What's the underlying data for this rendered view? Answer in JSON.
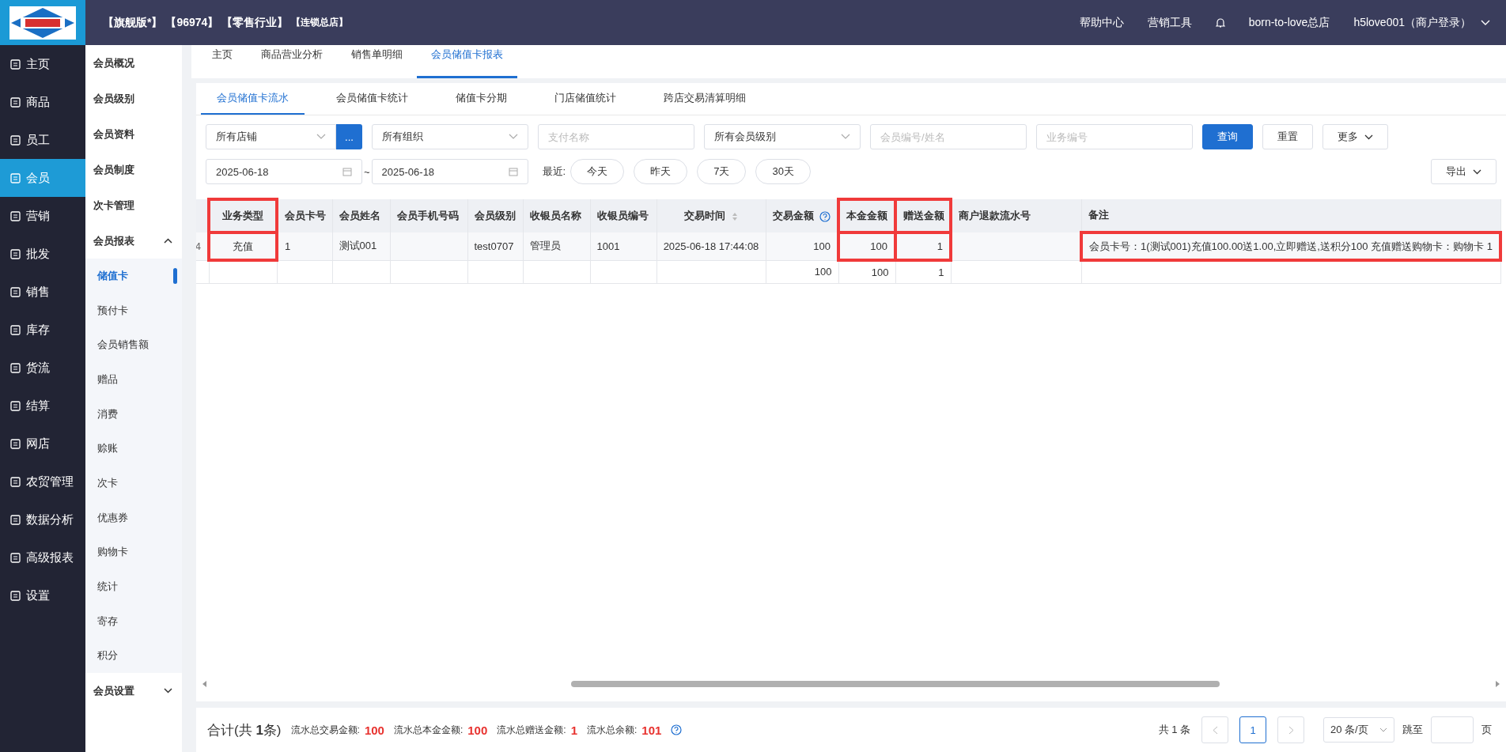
{
  "topbar": {
    "info": [
      "【旗舰版*】",
      "【96974】",
      "【零售行业】",
      "【连锁总店】"
    ],
    "links": [
      "帮助中心",
      "营销工具"
    ],
    "store": "born-to-love总店",
    "user": "h5love001（商户登录）"
  },
  "nav": [
    {
      "label": "主页",
      "selected": false
    },
    {
      "label": "商品",
      "selected": false
    },
    {
      "label": "员工",
      "selected": false
    },
    {
      "label": "会员",
      "selected": true
    },
    {
      "label": "营销",
      "selected": false
    },
    {
      "label": "批发",
      "selected": false
    },
    {
      "label": "销售",
      "selected": false
    },
    {
      "label": "库存",
      "selected": false
    },
    {
      "label": "货流",
      "selected": false
    },
    {
      "label": "结算",
      "selected": false
    },
    {
      "label": "网店",
      "selected": false
    },
    {
      "label": "农贸管理",
      "selected": false
    },
    {
      "label": "数据分析",
      "selected": false
    },
    {
      "label": "高级报表",
      "selected": false
    },
    {
      "label": "设置",
      "selected": false
    }
  ],
  "subnav": [
    {
      "label": "会员概况"
    },
    {
      "label": "会员级别"
    },
    {
      "label": "会员资料"
    },
    {
      "label": "会员制度"
    },
    {
      "label": "次卡管理"
    },
    {
      "label": "会员报表",
      "expanded": true,
      "children": [
        {
          "label": "储值卡",
          "selected": true
        },
        {
          "label": "预付卡",
          "selected": false
        },
        {
          "label": "会员销售额",
          "selected": false
        },
        {
          "label": "赠品",
          "selected": false
        },
        {
          "label": "消费",
          "selected": false
        },
        {
          "label": "赊账",
          "selected": false
        },
        {
          "label": "次卡",
          "selected": false
        },
        {
          "label": "优惠券",
          "selected": false
        },
        {
          "label": "购物卡",
          "selected": false
        },
        {
          "label": "统计",
          "selected": false
        },
        {
          "label": "寄存",
          "selected": false
        },
        {
          "label": "积分",
          "selected": false
        }
      ]
    },
    {
      "label": "会员设置",
      "expanded": false
    }
  ],
  "page_tabs": [
    {
      "label": "主页",
      "selected": false
    },
    {
      "label": "商品营业分析",
      "selected": false
    },
    {
      "label": "销售单明细",
      "selected": false
    },
    {
      "label": "会员储值卡报表",
      "selected": true
    }
  ],
  "report_tabs": [
    {
      "label": "会员储值卡流水",
      "selected": true
    },
    {
      "label": "会员储值卡统计",
      "selected": false
    },
    {
      "label": "储值卡分期",
      "selected": false
    },
    {
      "label": "门店储值统计",
      "selected": false
    },
    {
      "label": "跨店交易清算明细",
      "selected": false
    }
  ],
  "filters": [
    {
      "kind": "select",
      "value": "所有店铺",
      "more": "..."
    },
    {
      "kind": "select",
      "value": "所有组织"
    },
    {
      "kind": "input",
      "placeholder": "支付名称"
    },
    {
      "kind": "select",
      "value": "所有会员级别"
    },
    {
      "kind": "input",
      "placeholder": "会员编号/姓名"
    },
    {
      "kind": "input",
      "placeholder": "业务编号"
    },
    {
      "kind": "primary",
      "label": "查询"
    },
    {
      "kind": "button",
      "label": "重置"
    },
    {
      "kind": "dropdown",
      "label": "更多"
    }
  ],
  "date_range": {
    "start": "2025-06-18",
    "separator": "~",
    "end": "2025-06-18",
    "recent_label": "最近:",
    "quick": [
      "今天",
      "昨天",
      "7天",
      "30天"
    ],
    "export": "导出"
  },
  "table": {
    "columns": [
      {
        "header_highlighted": false,
        "cell_highlighted": false
      },
      {
        "label": "业务类型",
        "header_highlighted": true,
        "cell_highlighted": true
      },
      {
        "label": "会员卡号",
        "header_highlighted": false,
        "cell_highlighted": false
      },
      {
        "label": "会员姓名",
        "header_highlighted": false,
        "cell_highlighted": false
      },
      {
        "label": "会员手机号码",
        "header_highlighted": false,
        "cell_highlighted": false
      },
      {
        "label": "会员级别",
        "header_highlighted": false,
        "cell_highlighted": false
      },
      {
        "label": "收银员名称",
        "header_highlighted": false,
        "cell_highlighted": false
      },
      {
        "label": "收银员编号",
        "header_highlighted": false,
        "cell_highlighted": false
      },
      {
        "label": "交易时间",
        "header_highlighted": false,
        "cell_highlighted": false,
        "sortable": true
      },
      {
        "label": "交易金额",
        "header_highlighted": false,
        "cell_highlighted": false,
        "help": true
      },
      {
        "label": "本金金额",
        "header_highlighted": true,
        "cell_highlighted": true
      },
      {
        "label": "赠送金额",
        "header_highlighted": true,
        "cell_highlighted": true
      },
      {
        "label": "商户退款流水号",
        "header_highlighted": false,
        "cell_highlighted": false
      },
      {
        "label": "备注",
        "header_highlighted": false,
        "cell_highlighted": true
      }
    ],
    "rows": [
      {
        "column_1": "4",
        "type": "充值",
        "card_no": "1",
        "member_name": "测试001",
        "member_level": "test0707",
        "cashier_name": "管理员",
        "cashier_no": "1001",
        "time": "2025-06-18 17:44:08",
        "trade_amount": "100",
        "principal_amount": "100",
        "bonus_amount": "1",
        "note": "会员卡号：1(测试001)充值100.00送1.00,立即赠送,送积分100 充值赠送购物卡：购物卡 1"
      }
    ],
    "totals": {
      "trade_amount": "100",
      "principal_amount": "100",
      "bonus_amount": "1"
    }
  },
  "footer": {
    "summary": "合计(共 **1**条)",
    "stats": [
      {
        "label": "流水总交易金额:",
        "value": "100"
      },
      {
        "label": "流水总本金金额:",
        "value": "100"
      },
      {
        "label": "流水总赠送金额:",
        "value": "1"
      },
      {
        "label": "流水总余额:",
        "value": "101"
      }
    ],
    "pager": {
      "total": "共 1 条",
      "pages": [
        {
          "label": "1",
          "selected": true
        }
      ],
      "page_size": "20 条/页",
      "jump_label": "跳至",
      "page_suffix": "页"
    }
  }
}
